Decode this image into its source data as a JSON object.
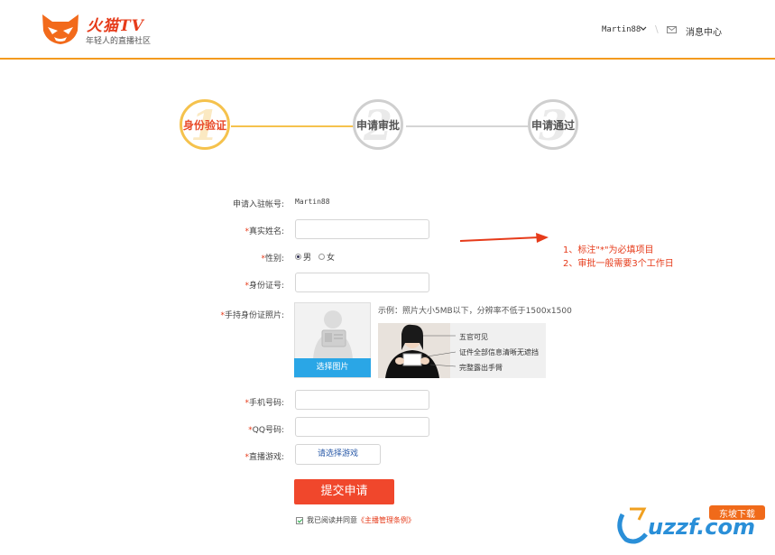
{
  "header": {
    "brand_title": "火猫TV",
    "brand_subtitle": "年轻人的直播社区",
    "username": "Martin88",
    "separator": "\\",
    "message_center": "消息中心"
  },
  "steps": [
    {
      "num": "1",
      "label": "身份验证",
      "active": true
    },
    {
      "num": "2",
      "label": "申请审批",
      "active": false
    },
    {
      "num": "3",
      "label": "申请通过",
      "active": false
    }
  ],
  "form": {
    "account_label": "申请入驻帐号:",
    "account_value": "Martin88",
    "required_mark": "*",
    "name_label": "真实姓名:",
    "gender_label": "性别:",
    "gender_male": "男",
    "gender_female": "女",
    "id_label": "身份证号:",
    "photo_label": "手持身份证照片:",
    "upload_button": "选择图片",
    "example_text": "示例：照片大小5MB以下，分辨率不低于1500x1500",
    "example_notes": [
      "五官可见",
      "证件全部信息清晰无遮挡",
      "完整露出手臂"
    ],
    "phone_label": "手机号码:",
    "qq_label": "QQ号码:",
    "game_label": "直播游戏:",
    "game_button": "请选择游戏",
    "submit_button": "提交申请",
    "agree_text": "我已阅读并同意",
    "agree_link": "《主播管理条例》"
  },
  "annotation": {
    "note1": "1、标注\"*\"为必填项目",
    "note2": "2、审批一般需要3个工作日"
  },
  "watermark": {
    "text": "uzzf.com",
    "badge": "东坡下载"
  },
  "colors": {
    "accent_orange": "#f39a1e",
    "step_active": "#f5c24d",
    "required_red": "#e63b1a",
    "submit": "#f0472c",
    "upload_blue": "#2aa6e6"
  }
}
